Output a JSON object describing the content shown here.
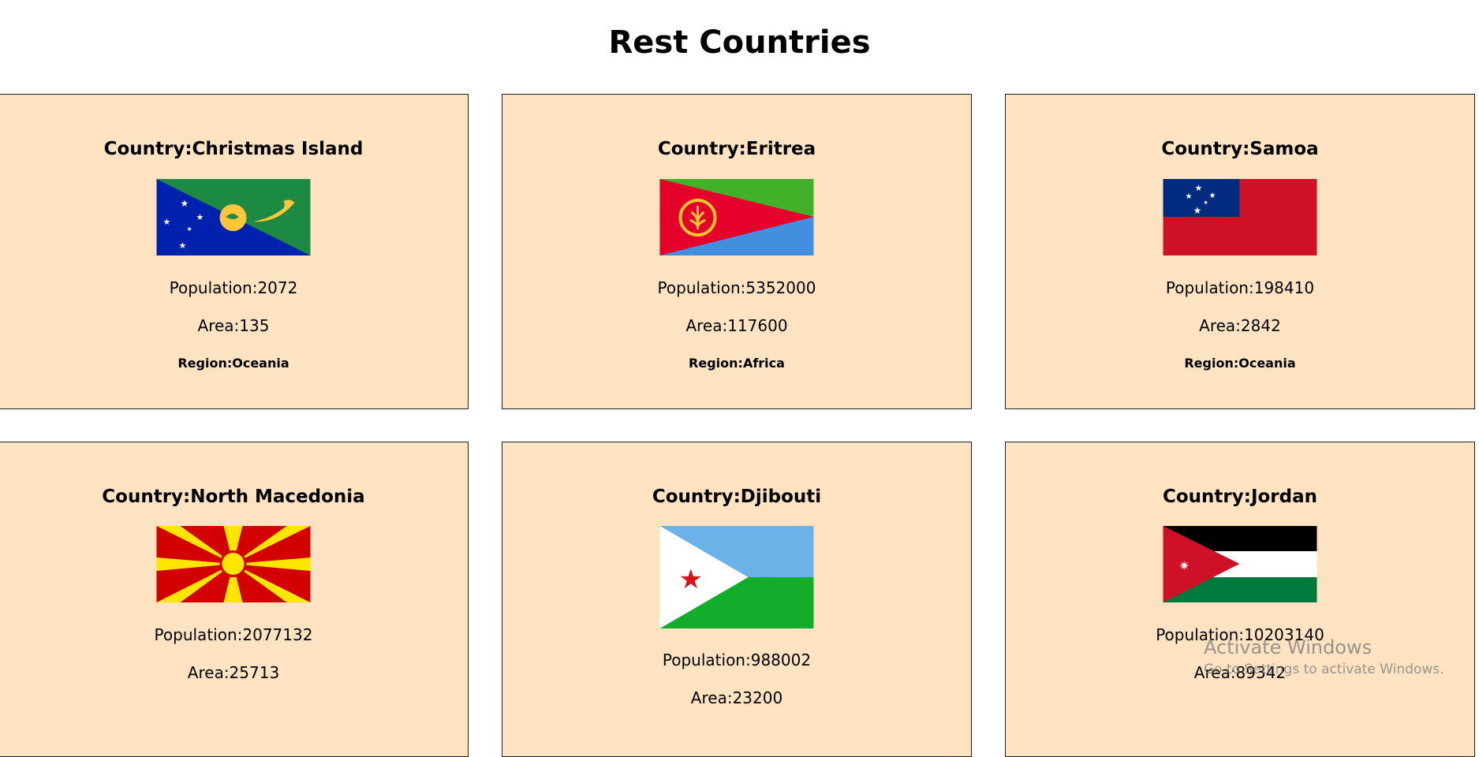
{
  "page": {
    "title": "Rest Countries"
  },
  "countries": [
    {
      "country": "Country:Christmas Island",
      "population": "Population:2072",
      "area": "Area:135",
      "region": "Region:Oceania",
      "flag_icon": "christmas-island-flag-icon"
    },
    {
      "country": "Country:Eritrea",
      "population": "Population:5352000",
      "area": "Area:117600",
      "region": "Region:Africa",
      "flag_icon": "eritrea-flag-icon"
    },
    {
      "country": "Country:Samoa",
      "population": "Population:198410",
      "area": "Area:2842",
      "region": "Region:Oceania",
      "flag_icon": "samoa-flag-icon"
    },
    {
      "country": "Country:North Macedonia",
      "population": "Population:2077132",
      "area": "Area:25713",
      "flag_icon": "north-macedonia-flag-icon"
    },
    {
      "country": "Country:Djibouti",
      "population": "Population:988002",
      "area": "Area:23200",
      "flag_icon": "djibouti-flag-icon"
    },
    {
      "country": "Country:Jordan",
      "population": "Population:10203140",
      "area": "Area:89342",
      "flag_icon": "jordan-flag-icon"
    }
  ],
  "os_watermark": {
    "title": "Activate Windows",
    "subtitle": "Go to Settings to activate Windows."
  },
  "colors": {
    "card_background": "#fde3c2",
    "card_border": "#222222",
    "page_background": "#ffffff"
  }
}
